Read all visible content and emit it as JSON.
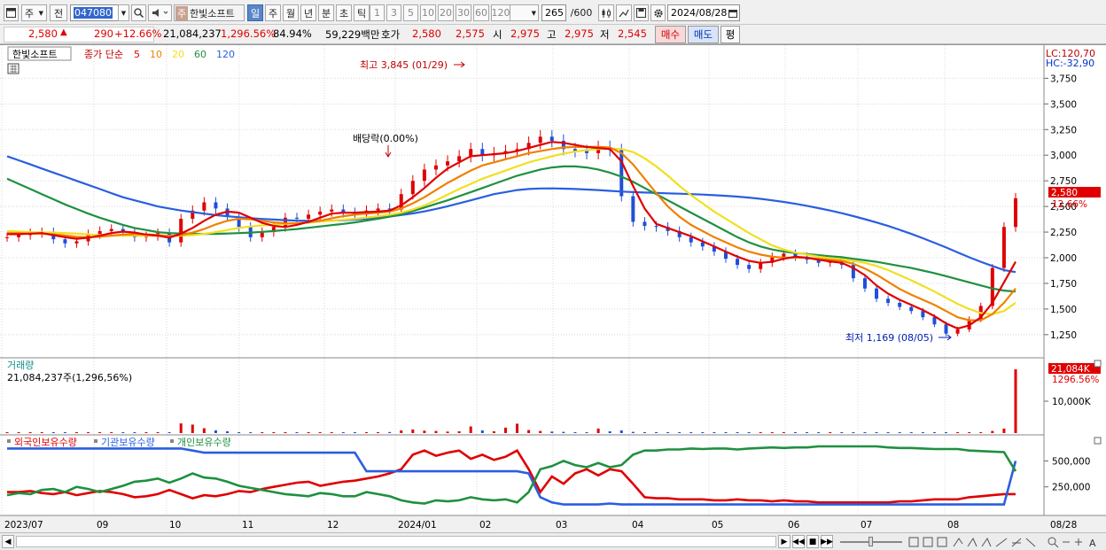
{
  "toolbar": {
    "market": "주",
    "prev_label": "전",
    "code": "047080",
    "stock_name": "한빛소프트",
    "stock_prefix": "주",
    "periods": [
      "일",
      "주",
      "월",
      "년",
      "분",
      "초",
      "틱"
    ],
    "active_period": "일",
    "intervals": [
      "1",
      "3",
      "5",
      "10",
      "20",
      "30",
      "60",
      "120"
    ],
    "count": "265",
    "count_max": "/600",
    "date": "2024/08/28"
  },
  "quote": {
    "price": "2,580",
    "arrow": "▲",
    "change": "290",
    "change_pct": "+12.66%",
    "volume": "21,084,237",
    "volume_pct": "1,296.56%",
    "ratio": "84.94%",
    "amount": "59,229백만",
    "bid_ask_label": "호가",
    "bid": "2,580",
    "ask": "2,575",
    "open_label": "시",
    "open": "2,975",
    "high_label": "고",
    "high": "2,975",
    "low_label": "저",
    "low": "2,545",
    "buy_label": "매수",
    "sell_label": "매도",
    "even_label": "평"
  },
  "chart_data": [
    {
      "type": "candlestick",
      "title": "한빛소프트",
      "legend": {
        "price_label": "종가 단순",
        "ma_periods": [
          "5",
          "10",
          "20",
          "60",
          "120"
        ]
      },
      "ma_colors": [
        "#e00000",
        "#f08000",
        "#f0e020",
        "#1f9040",
        "#2a5ee0"
      ],
      "y_ticks": [
        1250,
        1500,
        1750,
        2000,
        2250,
        2500,
        2750,
        3000,
        3250,
        3500,
        3750
      ],
      "y_tick_labels": [
        "1,250",
        "1,500",
        "1,750",
        "2,000",
        "2,250",
        "2,500",
        "2,750",
        "3,000",
        "3,250",
        "3,500",
        "3,750"
      ],
      "ylim": [
        1050,
        3900
      ],
      "lc_label": "LC:120,70",
      "hc_label": "HC:-32,90",
      "current_price_label": "2,580",
      "current_pct_label": "12.66%",
      "high_annotation": "최고 3,845 (01/29)",
      "low_annotation": "최저 1,169 (08/05)",
      "dividend_annotation": "배당락(0.00%)",
      "x_labels": [
        "2023/07",
        "09",
        "10",
        "11",
        "12",
        "2024/01",
        "02",
        "03",
        "04",
        "05",
        "06",
        "07",
        "08",
        "08/28"
      ],
      "close": [
        2200,
        2220,
        2240,
        2250,
        2180,
        2140,
        2160,
        2230,
        2260,
        2280,
        2250,
        2200,
        2210,
        2240,
        2150,
        2380,
        2460,
        2540,
        2480,
        2400,
        2300,
        2200,
        2250,
        2300,
        2390,
        2380,
        2420,
        2450,
        2470,
        2440,
        2420,
        2460,
        2480,
        2470,
        2620,
        2750,
        2860,
        2900,
        2940,
        2990,
        3060,
        3000,
        3020,
        3040,
        3060,
        3120,
        3180,
        3140,
        3060,
        3040,
        3020,
        3080,
        3050,
        2600,
        2350,
        2310,
        2300,
        2260,
        2200,
        2150,
        2110,
        2060,
        1990,
        1930,
        1890,
        1950,
        2010,
        2040,
        2010,
        1980,
        1950,
        1960,
        1930,
        1800,
        1700,
        1600,
        1560,
        1520,
        1480,
        1420,
        1350,
        1260,
        1300,
        1400,
        1530,
        1900,
        2300,
        2580
      ],
      "ma5": [
        2230,
        2230,
        2235,
        2240,
        2220,
        2200,
        2185,
        2195,
        2215,
        2240,
        2255,
        2245,
        2225,
        2215,
        2195,
        2235,
        2290,
        2360,
        2420,
        2450,
        2440,
        2390,
        2340,
        2310,
        2300,
        2320,
        2350,
        2390,
        2430,
        2440,
        2440,
        2445,
        2450,
        2460,
        2510,
        2590,
        2680,
        2780,
        2870,
        2930,
        2990,
        3000,
        3010,
        3020,
        3040,
        3070,
        3100,
        3130,
        3120,
        3100,
        3080,
        3070,
        3060,
        2940,
        2700,
        2480,
        2330,
        2290,
        2250,
        2210,
        2160,
        2110,
        2060,
        2010,
        1970,
        1950,
        1960,
        1990,
        2010,
        2000,
        1980,
        1965,
        1950,
        1900,
        1830,
        1730,
        1650,
        1590,
        1540,
        1490,
        1430,
        1360,
        1310,
        1340,
        1420,
        1560,
        1760,
        1960
      ],
      "ma10": [
        2240,
        2238,
        2236,
        2235,
        2228,
        2218,
        2205,
        2200,
        2205,
        2215,
        2225,
        2230,
        2228,
        2222,
        2212,
        2220,
        2245,
        2280,
        2325,
        2360,
        2380,
        2375,
        2360,
        2345,
        2335,
        2335,
        2345,
        2360,
        2385,
        2405,
        2420,
        2430,
        2440,
        2450,
        2480,
        2530,
        2590,
        2660,
        2730,
        2790,
        2850,
        2900,
        2930,
        2960,
        2990,
        3020,
        3040,
        3060,
        3075,
        3080,
        3080,
        3080,
        3075,
        3020,
        2910,
        2770,
        2630,
        2500,
        2400,
        2320,
        2260,
        2200,
        2150,
        2100,
        2060,
        2030,
        2010,
        2000,
        2000,
        2000,
        1990,
        1980,
        1970,
        1940,
        1895,
        1835,
        1765,
        1695,
        1640,
        1590,
        1540,
        1480,
        1420,
        1390,
        1390,
        1450,
        1560,
        1700
      ],
      "ma20": [
        2260,
        2255,
        2250,
        2248,
        2245,
        2240,
        2235,
        2228,
        2222,
        2218,
        2216,
        2215,
        2215,
        2214,
        2212,
        2214,
        2220,
        2232,
        2250,
        2270,
        2290,
        2305,
        2315,
        2322,
        2330,
        2338,
        2345,
        2352,
        2360,
        2370,
        2380,
        2392,
        2405,
        2420,
        2440,
        2470,
        2510,
        2560,
        2615,
        2670,
        2720,
        2770,
        2810,
        2850,
        2890,
        2930,
        2960,
        2990,
        3015,
        3035,
        3050,
        3060,
        3065,
        3060,
        3030,
        2970,
        2890,
        2800,
        2700,
        2610,
        2530,
        2450,
        2380,
        2310,
        2240,
        2180,
        2120,
        2080,
        2050,
        2030,
        2010,
        1995,
        1985,
        1970,
        1950,
        1920,
        1880,
        1830,
        1780,
        1725,
        1670,
        1610,
        1550,
        1500,
        1460,
        1450,
        1480,
        1560
      ],
      "ma60": [
        2770,
        2720,
        2670,
        2620,
        2570,
        2520,
        2475,
        2430,
        2390,
        2355,
        2320,
        2290,
        2270,
        2250,
        2240,
        2236,
        2233,
        2232,
        2233,
        2236,
        2240,
        2245,
        2252,
        2260,
        2270,
        2280,
        2292,
        2305,
        2318,
        2330,
        2345,
        2362,
        2380,
        2400,
        2425,
        2455,
        2490,
        2525,
        2560,
        2600,
        2640,
        2680,
        2720,
        2760,
        2800,
        2830,
        2860,
        2880,
        2890,
        2890,
        2880,
        2860,
        2830,
        2790,
        2740,
        2680,
        2620,
        2560,
        2500,
        2440,
        2380,
        2320,
        2260,
        2200,
        2150,
        2110,
        2080,
        2060,
        2045,
        2035,
        2025,
        2015,
        2005,
        1990,
        1975,
        1960,
        1940,
        1920,
        1900,
        1875,
        1850,
        1820,
        1790,
        1760,
        1730,
        1700,
        1680,
        1670
      ],
      "ma120": [
        2990,
        2950,
        2910,
        2870,
        2830,
        2790,
        2750,
        2710,
        2670,
        2630,
        2590,
        2560,
        2530,
        2500,
        2480,
        2460,
        2445,
        2430,
        2415,
        2405,
        2395,
        2385,
        2378,
        2372,
        2366,
        2362,
        2360,
        2360,
        2362,
        2366,
        2372,
        2380,
        2390,
        2402,
        2416,
        2432,
        2452,
        2476,
        2502,
        2530,
        2560,
        2590,
        2620,
        2640,
        2660,
        2670,
        2675,
        2676,
        2674,
        2670,
        2665,
        2660,
        2652,
        2645,
        2640,
        2636,
        2632,
        2628,
        2624,
        2620,
        2616,
        2610,
        2604,
        2596,
        2586,
        2574,
        2560,
        2544,
        2526,
        2506,
        2484,
        2460,
        2434,
        2406,
        2376,
        2344,
        2310,
        2272,
        2232,
        2190,
        2146,
        2100,
        2052,
        2004,
        1960,
        1920,
        1880,
        1860
      ]
    },
    {
      "type": "bar",
      "title": "거래량",
      "volume_label": "21,084,237주(1,296,56%)",
      "right_label": "21,084K",
      "right_pct": "1296.56%",
      "y_tick_label": "10,000K",
      "ylim": [
        0,
        21084
      ],
      "values": [
        120,
        90,
        80,
        70,
        110,
        60,
        90,
        80,
        100,
        70,
        60,
        50,
        70,
        90,
        80,
        3200,
        2800,
        1600,
        900,
        600,
        300,
        200,
        180,
        160,
        200,
        150,
        180,
        160,
        140,
        200,
        180,
        220,
        300,
        350,
        900,
        1200,
        800,
        700,
        500,
        600,
        2200,
        900,
        600,
        1800,
        3100,
        1000,
        700,
        500,
        400,
        300,
        250,
        1500,
        600,
        900,
        400,
        300,
        250,
        200,
        180,
        160,
        150,
        140,
        160,
        150,
        140,
        300,
        200,
        180,
        160,
        150,
        140,
        130,
        120,
        150,
        140,
        130,
        120,
        140,
        120,
        130,
        160,
        180,
        200,
        260,
        300,
        700,
        1500,
        21084
      ]
    },
    {
      "type": "line",
      "title": "외국인보유수량",
      "series": [
        {
          "name": "외국인보유수량",
          "color": "#e00000",
          "values": [
            200000,
            200000,
            210000,
            190000,
            180000,
            200000,
            170000,
            190000,
            210000,
            200000,
            180000,
            150000,
            160000,
            180000,
            220000,
            180000,
            140000,
            170000,
            160000,
            180000,
            210000,
            200000,
            230000,
            250000,
            270000,
            290000,
            300000,
            260000,
            280000,
            300000,
            310000,
            330000,
            350000,
            380000,
            420000,
            560000,
            600000,
            550000,
            580000,
            600000,
            520000,
            560000,
            510000,
            540000,
            600000,
            420000,
            200000,
            350000,
            280000,
            380000,
            420000,
            360000,
            420000,
            400000,
            280000,
            150000,
            140000,
            140000,
            130000,
            130000,
            130000,
            120000,
            120000,
            130000,
            120000,
            120000,
            110000,
            120000,
            110000,
            110000,
            100000,
            100000,
            100000,
            100000,
            100000,
            100000,
            100000,
            110000,
            110000,
            120000,
            130000,
            130000,
            130000,
            150000,
            160000,
            170000,
            180000,
            180000
          ]
        },
        {
          "name": "기관보유수량",
          "color": "#2a5ee0",
          "values": [
            620000,
            620000,
            620000,
            620000,
            620000,
            620000,
            620000,
            620000,
            620000,
            620000,
            620000,
            620000,
            620000,
            620000,
            620000,
            620000,
            600000,
            580000,
            580000,
            580000,
            580000,
            580000,
            580000,
            580000,
            580000,
            580000,
            580000,
            580000,
            580000,
            580000,
            580000,
            400000,
            400000,
            400000,
            400000,
            400000,
            400000,
            400000,
            400000,
            400000,
            400000,
            400000,
            400000,
            400000,
            400000,
            380000,
            150000,
            100000,
            80000,
            80000,
            80000,
            80000,
            90000,
            80000,
            80000,
            80000,
            80000,
            80000,
            80000,
            80000,
            80000,
            80000,
            80000,
            80000,
            80000,
            80000,
            80000,
            80000,
            80000,
            80000,
            80000,
            80000,
            80000,
            80000,
            80000,
            80000,
            80000,
            80000,
            80000,
            80000,
            80000,
            80000,
            80000,
            80000,
            80000,
            80000,
            80000,
            500000
          ]
        },
        {
          "name": "개인보유수량",
          "color": "#1f9040",
          "values": [
            170000,
            190000,
            180000,
            220000,
            230000,
            200000,
            250000,
            230000,
            200000,
            230000,
            260000,
            300000,
            310000,
            330000,
            290000,
            330000,
            380000,
            340000,
            330000,
            300000,
            260000,
            240000,
            220000,
            200000,
            180000,
            170000,
            160000,
            190000,
            180000,
            160000,
            160000,
            200000,
            180000,
            160000,
            120000,
            100000,
            90000,
            120000,
            110000,
            120000,
            150000,
            130000,
            120000,
            130000,
            100000,
            200000,
            420000,
            450000,
            500000,
            460000,
            440000,
            480000,
            440000,
            460000,
            560000,
            600000,
            600000,
            610000,
            610000,
            620000,
            615000,
            620000,
            620000,
            610000,
            620000,
            625000,
            630000,
            625000,
            630000,
            630000,
            640000,
            640000,
            640000,
            640000,
            640000,
            640000,
            630000,
            625000,
            625000,
            620000,
            615000,
            615000,
            615000,
            600000,
            595000,
            590000,
            585000,
            400000
          ]
        }
      ],
      "legend": [
        "외국인보유수량",
        "기관보유수량",
        "개인보유수량"
      ],
      "y_tick_labels": [
        "500,000",
        "250,000"
      ],
      "ylim": [
        0,
        700000
      ]
    }
  ]
}
